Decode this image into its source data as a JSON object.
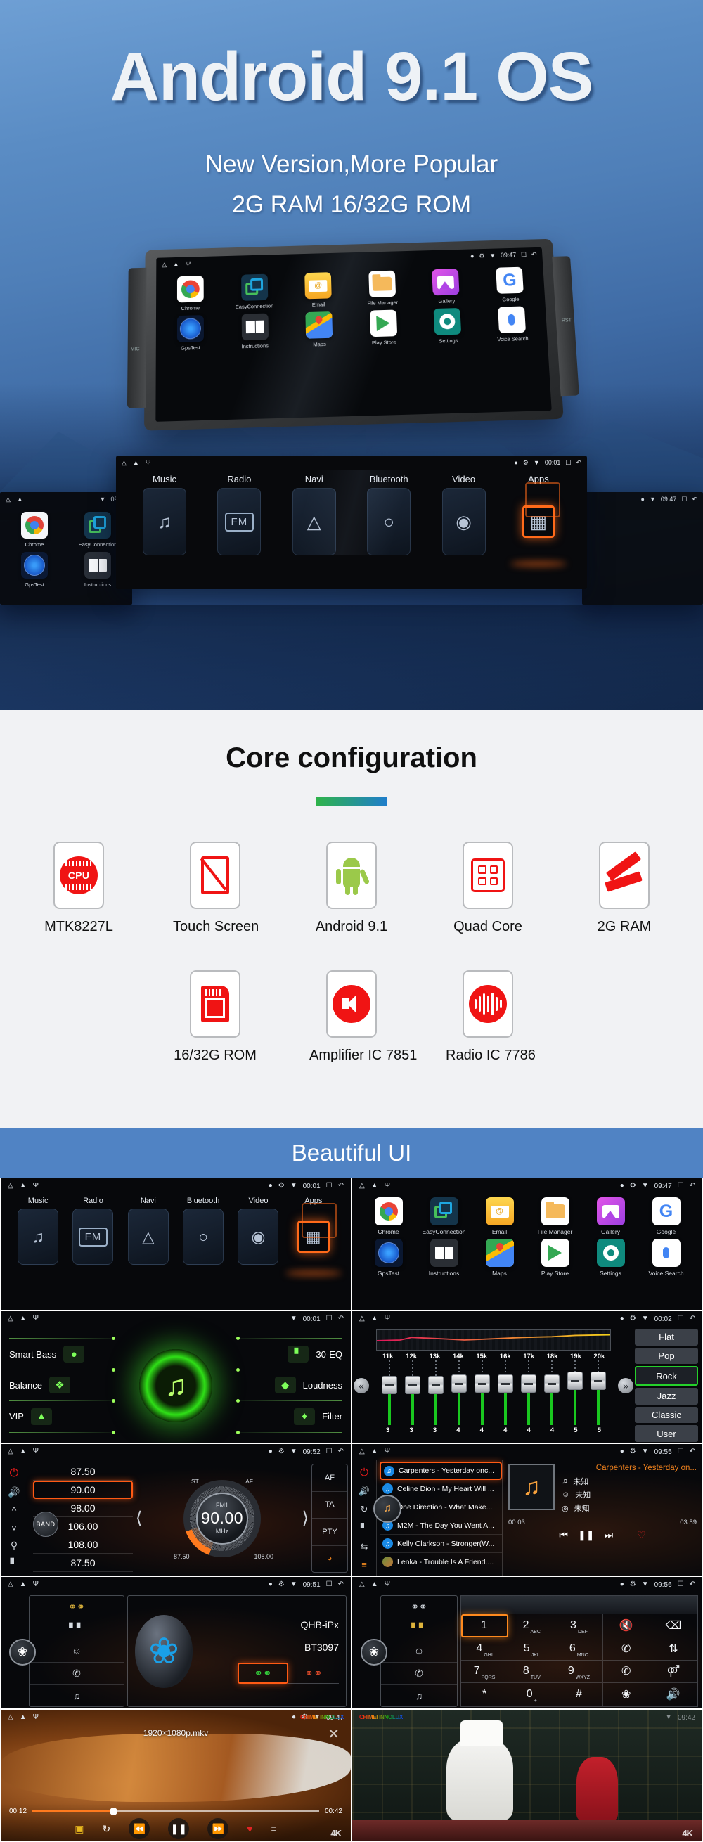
{
  "hero": {
    "title": "Android 9.1 OS",
    "subtitle1": "New Version,More Popular",
    "subtitle2": "2G RAM 16/32G ROM",
    "device_labels": {
      "mic": "MIC",
      "rst": "RST"
    },
    "status": {
      "time": "09:47",
      "time_alt": "00:01"
    },
    "apps_row1": [
      {
        "label": "Chrome",
        "icon": "chrome-icon"
      },
      {
        "label": "EasyConnection",
        "icon": "easyconnection-icon"
      },
      {
        "label": "Email",
        "icon": "email-icon"
      },
      {
        "label": "File Manager",
        "icon": "file-manager-icon"
      },
      {
        "label": "Gallery",
        "icon": "gallery-icon"
      },
      {
        "label": "Google",
        "icon": "google-icon"
      }
    ],
    "apps_row2": [
      {
        "label": "GpsTest",
        "icon": "gps-test-icon"
      },
      {
        "label": "Instructions",
        "icon": "instructions-icon"
      },
      {
        "label": "Maps",
        "icon": "maps-icon"
      },
      {
        "label": "Play Store",
        "icon": "play-store-icon"
      },
      {
        "label": "Settings",
        "icon": "settings-icon"
      },
      {
        "label": "Voice Search",
        "icon": "voice-search-icon"
      }
    ],
    "main_menu": [
      {
        "label": "Music",
        "icon": "music-note-icon"
      },
      {
        "label": "Radio",
        "icon": "fm-icon"
      },
      {
        "label": "Navi",
        "icon": "navigation-map-icon"
      },
      {
        "label": "Bluetooth",
        "icon": "bluetooth-globe-icon"
      },
      {
        "label": "Video",
        "icon": "film-reel-icon"
      },
      {
        "label": "Apps",
        "icon": "apps-grid-icon"
      }
    ]
  },
  "core": {
    "heading": "Core configuration",
    "accent_from": "#2fb34a",
    "accent_to": "#1f7ecb",
    "row1": [
      {
        "label": "MTK8227L",
        "icon": "cpu-icon",
        "badge": "CPU"
      },
      {
        "label": "Touch Screen",
        "icon": "touch-screen-icon"
      },
      {
        "label": "Android 9.1",
        "icon": "android-robot-icon"
      },
      {
        "label": "Quad Core",
        "icon": "quad-core-chip-icon"
      },
      {
        "label": "2G RAM",
        "icon": "ram-stick-icon"
      }
    ],
    "row2": [
      {
        "label": "16/32G ROM",
        "icon": "sd-card-icon"
      },
      {
        "label": "Amplifier IC 7851",
        "icon": "speaker-icon"
      },
      {
        "label": "Radio IC 7786",
        "icon": "radio-wave-icon"
      }
    ]
  },
  "beautiful_ui": {
    "banner": "Beautiful UI",
    "panels": {
      "main_menu": {
        "time": "00:01",
        "items": [
          "Music",
          "Radio",
          "Navi",
          "Bluetooth",
          "Video",
          "Apps"
        ]
      },
      "apps": {
        "time": "09:47",
        "row1": [
          "Chrome",
          "EasyConnection",
          "Email",
          "File Manager",
          "Gallery",
          "Google"
        ],
        "row2": [
          "GpsTest",
          "Instructions",
          "Maps",
          "Play Store",
          "Settings",
          "Voice Search"
        ]
      },
      "sound": {
        "time": "00:01",
        "left": [
          "Smart Bass",
          "Balance",
          "VIP"
        ],
        "right": [
          "30-EQ",
          "Loudness",
          "Filter"
        ]
      },
      "equalizer": {
        "time": "00:02",
        "bands": [
          "11k",
          "12k",
          "13k",
          "14k",
          "15k",
          "16k",
          "17k",
          "18k",
          "19k",
          "20k"
        ],
        "values": [
          3,
          3,
          3,
          4,
          4,
          4,
          4,
          4,
          5,
          5
        ],
        "presets": [
          "Flat",
          "Pop",
          "Rock",
          "Jazz",
          "Classic",
          "User"
        ],
        "selected_preset": "Rock"
      },
      "radio": {
        "time": "09:52",
        "presets": [
          "87.50",
          "90.00",
          "98.00",
          "106.00",
          "108.00",
          "87.50"
        ],
        "selected_preset": "90.00",
        "band": "FM1",
        "frequency": "90.00",
        "unit": "MHz",
        "band_button": "BAND",
        "dial_min": "87.50",
        "dial_max": "108.00",
        "top_labels": [
          "ST",
          "AF"
        ],
        "side_buttons": [
          "AF",
          "TA",
          "PTY"
        ]
      },
      "music": {
        "time": "09:55",
        "playlist": [
          "Carpenters - Yesterday onc...",
          "Celine Dion - My Heart Will ...",
          "One Direction - What Make...",
          "M2M - The Day You Went A...",
          "Kelly Clarkson - Stronger(W...",
          "Lenka - Trouble Is A Friend...."
        ],
        "now_playing": "Carpenters - Yesterday on...",
        "meta": {
          "track": "未知",
          "artist": "未知",
          "album": "未知"
        },
        "elapsed": "00:03",
        "duration": "03:59"
      },
      "bluetooth": {
        "time": "09:51",
        "device_name": "QHB-iPx",
        "pin": "BT3097"
      },
      "dialpad": {
        "time": "09:56",
        "keys": [
          {
            "main": "1",
            "sub": ""
          },
          {
            "main": "2",
            "sub": "ABC"
          },
          {
            "main": "3",
            "sub": "DEF"
          },
          {
            "main": "4",
            "sub": "GHI"
          },
          {
            "main": "5",
            "sub": "JKL"
          },
          {
            "main": "6",
            "sub": "MNO"
          },
          {
            "main": "7",
            "sub": "PQRS"
          },
          {
            "main": "8",
            "sub": "TUV"
          },
          {
            "main": "9",
            "sub": "WXYZ"
          },
          {
            "main": "*",
            "sub": ""
          },
          {
            "main": "0",
            "sub": "+"
          },
          {
            "main": "#",
            "sub": ""
          }
        ],
        "selected_key": "1"
      },
      "video_left": {
        "time": "09:47",
        "filename": "1920×1080p.mkv",
        "elapsed": "00:12",
        "duration": "00:42",
        "brand": "CHIMEI INNOLUX",
        "badge": "4K"
      },
      "video_right": {
        "time": "09:42",
        "brand": "CHIMEI INNOLUX",
        "badge": "4K"
      }
    }
  }
}
